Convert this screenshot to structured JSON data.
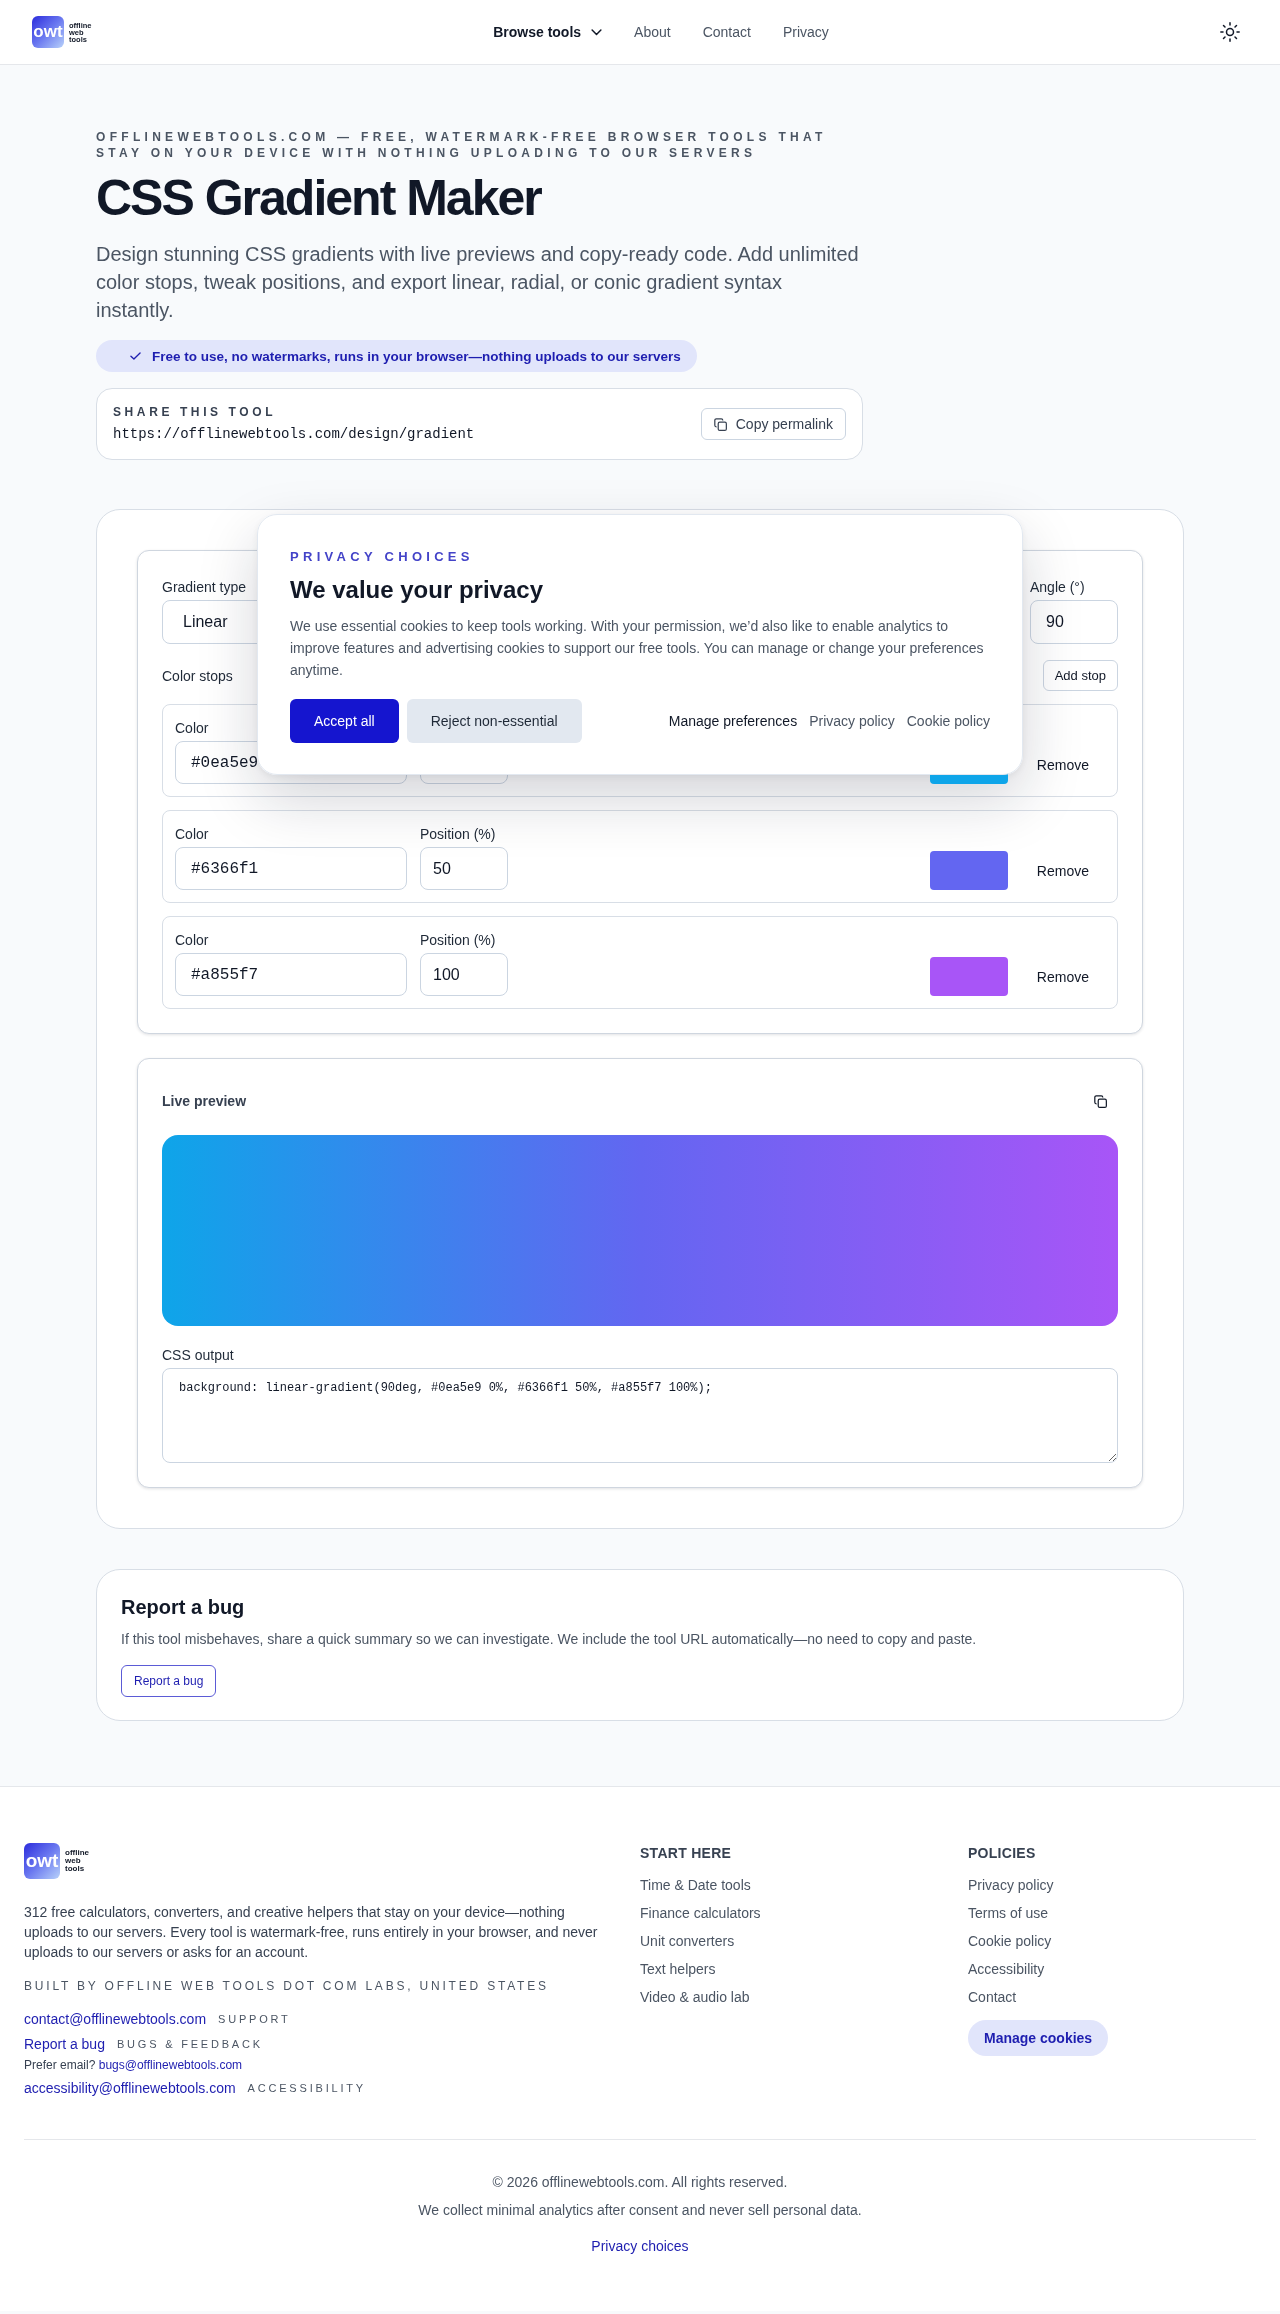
{
  "header": {
    "logo": {
      "mark": "owt",
      "wordmark": "offline web tools"
    },
    "nav": [
      {
        "label": "Browse tools",
        "kind": "menu"
      },
      {
        "label": "About",
        "kind": "link"
      },
      {
        "label": "Contact",
        "kind": "link"
      },
      {
        "label": "Privacy",
        "kind": "link"
      }
    ]
  },
  "hero": {
    "eyebrow": "OFFLINEWEBTOOLS.COM — FREE, WATERMARK-FREE BROWSER TOOLS THAT STAY ON YOUR DEVICE WITH NOTHING UPLOADING TO OUR SERVERS",
    "title": "CSS Gradient Maker",
    "description": "Design stunning CSS gradients with live previews and copy-ready code. Add unlimited color stops, tweak positions, and export linear, radial, or conic gradient syntax instantly.",
    "badge": "Free to use, no watermarks, runs in your browser—nothing uploads to our servers",
    "share": {
      "label": "SHARE THIS TOOL",
      "url": "https://offlinewebtools.com/design/gradient",
      "button": "Copy permalink"
    }
  },
  "tool": {
    "gradient_type": {
      "label": "Gradient type",
      "value": "Linear"
    },
    "angle": {
      "label": "Angle (°)",
      "value": "90"
    },
    "stops_label": "Color stops",
    "add_stop": "Add stop",
    "stops": [
      {
        "color_label": "Color",
        "color_value": "#0ea5e9",
        "color": "#0ea5e9",
        "remove": "Remove"
      },
      {
        "color_label": "Color",
        "color_value": "#6366f1",
        "position_label": "Position (%)",
        "position_value": "50",
        "color": "#6366f1",
        "remove": "Remove"
      },
      {
        "color_label": "Color",
        "color_value": "#a855f7",
        "position_label": "Position (%)",
        "position_value": "100",
        "color": "#a855f7",
        "remove": "Remove"
      }
    ],
    "preview": {
      "label": "Live preview",
      "css_label": "CSS output",
      "css_code": "background: linear-gradient(90deg, #0ea5e9 0%, #6366f1 50%, #a855f7 100%);"
    }
  },
  "privacy_dialog": {
    "eyebrow": "PRIVACY CHOICES",
    "title": "We value your privacy",
    "text": "We use essential cookies to keep tools working. With your permission, we’d also like to enable analytics to improve features and advertising cookies to support our free tools. You can manage or change your preferences anytime.",
    "buttons": [
      {
        "label": "Accept all",
        "kind": "primary"
      },
      {
        "label": "Reject non-essential",
        "kind": "secondary"
      }
    ],
    "links": [
      {
        "label": "Manage preferences",
        "kind": "strong"
      },
      {
        "label": "Privacy policy",
        "kind": "muted"
      },
      {
        "label": "Cookie policy",
        "kind": "muted"
      }
    ]
  },
  "report": {
    "title": "Report a bug",
    "text": "If this tool misbehaves, share a quick summary so we can investigate. We include the tool URL automatically—no need to copy and paste.",
    "button": "Report a bug"
  },
  "footer": {
    "logo": {
      "mark": "owt",
      "wordmark": "offline web tools"
    },
    "description": "312 free calculators, converters, and creative helpers that stay on your device—nothing uploads to our servers. Every tool is watermark-free, runs entirely in your browser, and never uploads to our servers or asks for an account.",
    "built_by": "BUILT BY OFFLINE WEB TOOLS DOT COM LABS, UNITED STATES",
    "contacts": [
      {
        "kind": "email",
        "link": "contact@offlinewebtools.com",
        "tag": "SUPPORT"
      },
      {
        "kind": "page",
        "link": "Report a bug",
        "tag": "BUGS & FEEDBACK"
      },
      {
        "kind": "note",
        "text": "Prefer email?",
        "link": "bugs@offlinewebtools.com"
      },
      {
        "kind": "email",
        "link": "accessibility@offlinewebtools.com",
        "tag": "ACCESSIBILITY"
      }
    ],
    "columns": [
      {
        "title": "START HERE",
        "links": [
          "Time & Date tools",
          "Finance calculators",
          "Unit converters",
          "Text helpers",
          "Video & audio lab"
        ]
      },
      {
        "title": "POLICIES",
        "links": [
          "Privacy policy",
          "Terms of use",
          "Cookie policy",
          "Accessibility",
          "Contact"
        ],
        "button": "Manage cookies"
      }
    ],
    "copyright": "© 2026 offlinewebtools.com. All rights reserved.",
    "notice": "We collect minimal analytics after consent and never sell personal data.",
    "privacy_link": "Privacy choices"
  }
}
